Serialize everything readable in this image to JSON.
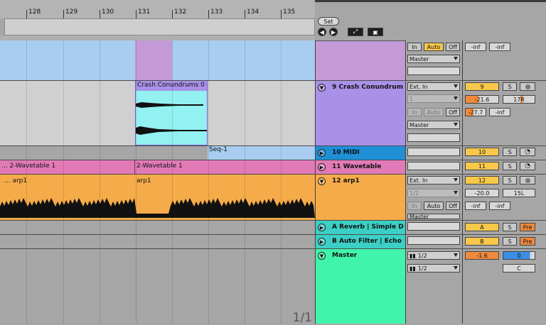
{
  "ruler": {
    "bars": [
      "128",
      "129",
      "130",
      "131",
      "132",
      "133",
      "134",
      "135"
    ]
  },
  "top_controls": {
    "set_label": "Set"
  },
  "clips": {
    "crash": "Crash Conundrums 0",
    "seq": "Seq-1",
    "wavetable_left": "... 2-Wavetable 1",
    "wavetable_right": "2-Wavetable 1",
    "arp_left": "... arp1",
    "arp_right": "arp1"
  },
  "tracks": [
    {
      "name": "",
      "color": "#c39ad6"
    },
    {
      "name": "9 Crash Conundrum",
      "color": "#a991e8"
    },
    {
      "name": "10 MIDI",
      "color": "#1f8fd6"
    },
    {
      "name": "11 Wavetable",
      "color": "#e27ab8"
    },
    {
      "name": "12 arp1",
      "color": "#f5ab4a"
    },
    {
      "name": "A Reverb | Simple D",
      "color": "#3ccfc5"
    },
    {
      "name": "B Auto Filter | Echo",
      "color": "#3ccfc5"
    },
    {
      "name": "Master",
      "color": "#40f5ab"
    }
  ],
  "io": {
    "in": "In",
    "auto": "Auto",
    "off": "Off",
    "master": "Master",
    "ext_in": "Ext. In",
    "ch1": "1",
    "ch12": "1/2",
    "master_out1": "1/2",
    "master_out2": "1/2"
  },
  "mixer": {
    "top_inf_a": "-inf",
    "top_inf_b": "-inf",
    "t9_num": "9",
    "t9_s": "S",
    "t9_vol": "-21.6",
    "t9_pan": "17R",
    "t9_peak": "-27.7",
    "t9_inf": "-inf",
    "t10_num": "10",
    "t10_s": "S",
    "t11_num": "11",
    "t11_s": "S",
    "t12_num": "12",
    "t12_s": "S",
    "t12_vol": "-20.0",
    "t12_pan": "15L",
    "t12_inf_a": "-inf",
    "t12_inf_b": "-inf",
    "ra_label": "A",
    "ra_s": "S",
    "ra_pre": "Pre",
    "rb_label": "B",
    "rb_s": "S",
    "rb_pre": "Pre",
    "m_vol": "-1.6",
    "m_pan": "0",
    "m_c": "C"
  },
  "footer": {
    "page": "1/1"
  }
}
